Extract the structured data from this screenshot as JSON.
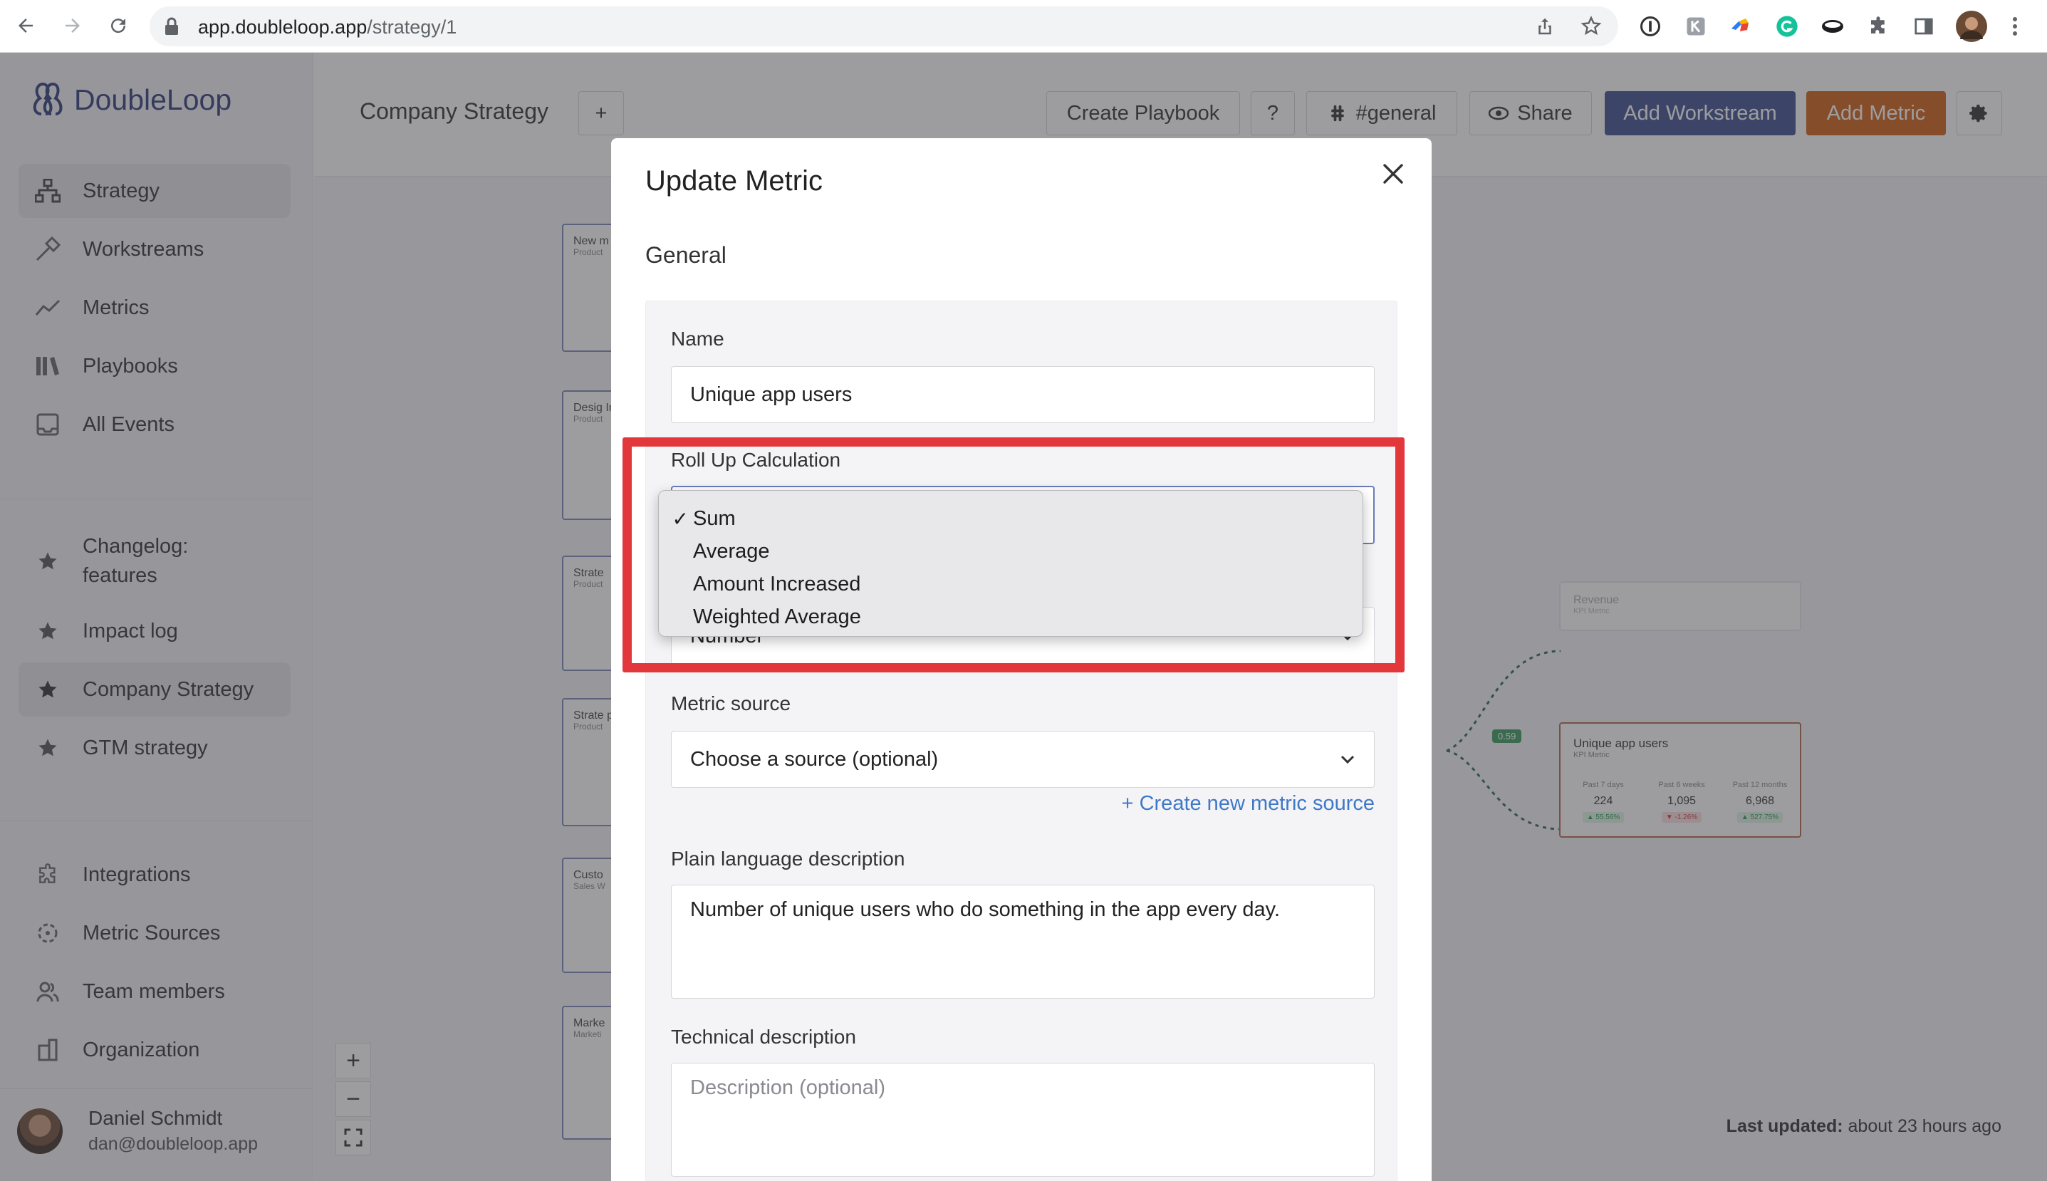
{
  "browser": {
    "url_host": "app.doubleloop.app",
    "url_path": "/strategy/1"
  },
  "sidebar": {
    "brand": "DoubleLoop",
    "primary_items": [
      {
        "label": "Strategy",
        "icon": "hierarchy-icon",
        "active": true
      },
      {
        "label": "Workstreams",
        "icon": "hammer-icon"
      },
      {
        "label": "Metrics",
        "icon": "trend-line-icon"
      },
      {
        "label": "Playbooks",
        "icon": "books-icon"
      },
      {
        "label": "All Events",
        "icon": "inbox-icon"
      }
    ],
    "favorites": [
      {
        "label": "Changelog: features",
        "icon": "star-icon"
      },
      {
        "label": "Impact log",
        "icon": "star-icon"
      },
      {
        "label": "Company Strategy",
        "icon": "star-icon",
        "active": true
      },
      {
        "label": "GTM strategy",
        "icon": "star-icon"
      }
    ],
    "settings_items": [
      {
        "label": "Integrations",
        "icon": "puzzle-icon"
      },
      {
        "label": "Metric Sources",
        "icon": "source-icon"
      },
      {
        "label": "Team members",
        "icon": "people-icon"
      },
      {
        "label": "Organization",
        "icon": "building-icon"
      }
    ],
    "user": {
      "name": "Daniel Schmidt",
      "email": "dan@doubleloop.app"
    }
  },
  "header": {
    "title": "Company Strategy",
    "add_label": "+",
    "create_playbook": "Create Playbook",
    "help": "?",
    "slack_channel": "#general",
    "share": "Share",
    "add_workstream": "Add Workstream",
    "add_metric": "Add Metric"
  },
  "canvas": {
    "nodes": [
      {
        "title": "New m integr",
        "sub": "Product"
      },
      {
        "title": "Desig Improv",
        "sub": "Product"
      },
      {
        "title": "Strate",
        "sub": "Product"
      },
      {
        "title": "Strate parity)",
        "sub": "Product"
      },
      {
        "title": "Custo",
        "sub": "Sales W"
      },
      {
        "title": "Marke",
        "sub": "Marketi"
      }
    ],
    "revenue_card": {
      "title": "Revenue",
      "sub": "KPI Metric"
    },
    "kpi_card": {
      "title": "Unique app users",
      "sub": "KPI Metric",
      "columns": [
        {
          "label": "Past 7 days",
          "value": "224",
          "delta": "▲ 55.56%",
          "color": "#2e9b4e"
        },
        {
          "label": "Past 6 weeks",
          "value": "1,095",
          "delta": "▼ -1.26%",
          "color": "#d33a3a"
        },
        {
          "label": "Past 12 months",
          "value": "6,968",
          "delta": "▲ 527.75%",
          "color": "#2e9b4e"
        }
      ]
    },
    "edge_badge": "0.59",
    "last_updated_label": "Last updated:",
    "last_updated_value": "about 23 hours ago"
  },
  "modal": {
    "title": "Update Metric",
    "section": "General",
    "name_label": "Name",
    "name_value": "Unique app users",
    "rollup_label": "Roll Up Calculation",
    "rollup_options": [
      {
        "label": "Sum",
        "selected": true
      },
      {
        "label": "Average",
        "selected": false
      },
      {
        "label": "Amount Increased",
        "selected": false
      },
      {
        "label": "Weighted Average",
        "selected": false
      }
    ],
    "checkmark": "✓",
    "format_value": "Number",
    "source_label": "Metric source",
    "source_placeholder": "Choose a source (optional)",
    "create_source_link": "+ Create new metric source",
    "plain_desc_label": "Plain language description",
    "plain_desc_value": "Number of unique users who do something in the app every day.",
    "tech_desc_label": "Technical description",
    "tech_desc_placeholder": "Description (optional)"
  },
  "colors": {
    "brand_navy": "#3c4f8f",
    "accent_orange": "#cf5f12",
    "highlight_red": "#e2383c",
    "link_blue": "#3f78c8"
  }
}
